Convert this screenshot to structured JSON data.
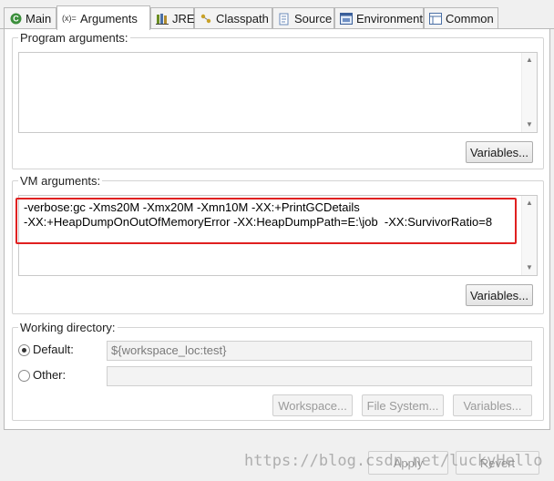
{
  "tabs": [
    {
      "label": "Main",
      "icon": "main-tab-icon"
    },
    {
      "label": "Arguments",
      "icon": "arguments-icon",
      "active": true
    },
    {
      "label": "JRE",
      "icon": "jre-library-icon"
    },
    {
      "label": "Classpath",
      "icon": "classpath-icon"
    },
    {
      "label": "Source",
      "icon": "source-icon"
    },
    {
      "label": "Environment",
      "icon": "environment-icon"
    },
    {
      "label": "Common",
      "icon": "common-icon"
    }
  ],
  "program_args": {
    "label": "Program arguments:",
    "value": "",
    "variables_button": "Variables..."
  },
  "vm_args": {
    "label": "VM arguments:",
    "line1": "-verbose:gc -Xms20M -Xmx20M -Xmn10M -XX:+PrintGCDetails",
    "line2": "-XX:+HeapDumpOnOutOfMemoryError -XX:HeapDumpPath=E:\\job  -XX:SurvivorRatio=8",
    "highlight_color": "#e02020",
    "variables_button": "Variables..."
  },
  "working_dir": {
    "label": "Working directory:",
    "default_label": "Default:",
    "default_value": "${workspace_loc:test}",
    "default_selected": true,
    "other_label": "Other:",
    "other_value": "",
    "workspace_button": "Workspace...",
    "filesystem_button": "File System...",
    "variables_button": "Variables..."
  },
  "footer": {
    "apply_button": "Apply",
    "revert_button": "Revert"
  },
  "watermark": "https://blog.csdn.net/luckyHello"
}
